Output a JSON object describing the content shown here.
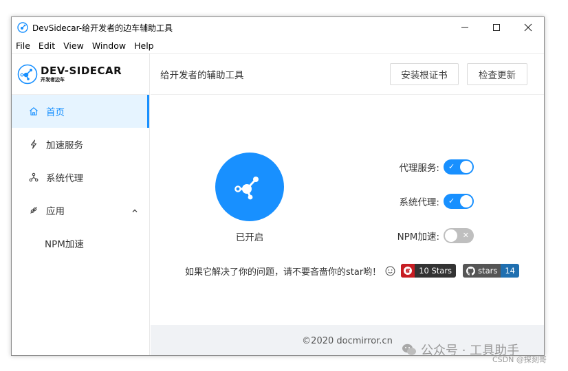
{
  "window": {
    "title": "DevSidecar-给开发者的边车辅助工具",
    "controls": {
      "minimize": "—",
      "maximize": "☐",
      "close": "✕"
    }
  },
  "menu": [
    "File",
    "Edit",
    "View",
    "Window",
    "Help"
  ],
  "logo": {
    "title": "DEV-SIDECAR",
    "subtitle": "开发者边车"
  },
  "sidebar": {
    "items": [
      {
        "label": "首页",
        "icon": "home-icon",
        "active": true
      },
      {
        "label": "加速服务",
        "icon": "thunderbolt-icon"
      },
      {
        "label": "系统代理",
        "icon": "apartment-icon"
      },
      {
        "label": "应用",
        "icon": "api-icon",
        "expanded": true
      }
    ],
    "sub_items": [
      {
        "label": "NPM加速"
      }
    ]
  },
  "header": {
    "title": "给开发者的辅助工具",
    "install_cert": "安装根证书",
    "check_update": "检查更新"
  },
  "main": {
    "status": "已开启",
    "switches": [
      {
        "label": "代理服务:",
        "on": true,
        "mark": "✓"
      },
      {
        "label": "系统代理:",
        "on": true,
        "mark": "✓"
      },
      {
        "label": "NPM加速:",
        "on": false,
        "mark": "✕"
      }
    ],
    "star_message": "如果它解决了你的问题，请不要吝啬你的star哟！",
    "gitee_badge": "10 Stars",
    "github_badge": {
      "label": "stars",
      "count": "14"
    }
  },
  "footer": {
    "copyright": "©2020 docmirror.cn"
  },
  "watermark": {
    "primary": "公众号 · 工具助手",
    "secondary": "CSDN @探刻哥"
  },
  "colors": {
    "primary": "#1890ff",
    "active_bg": "#e6f4ff",
    "footer_bg": "#f0f2f5",
    "gitee_red": "#c71d23",
    "github_blue": "#1f6fb0"
  }
}
